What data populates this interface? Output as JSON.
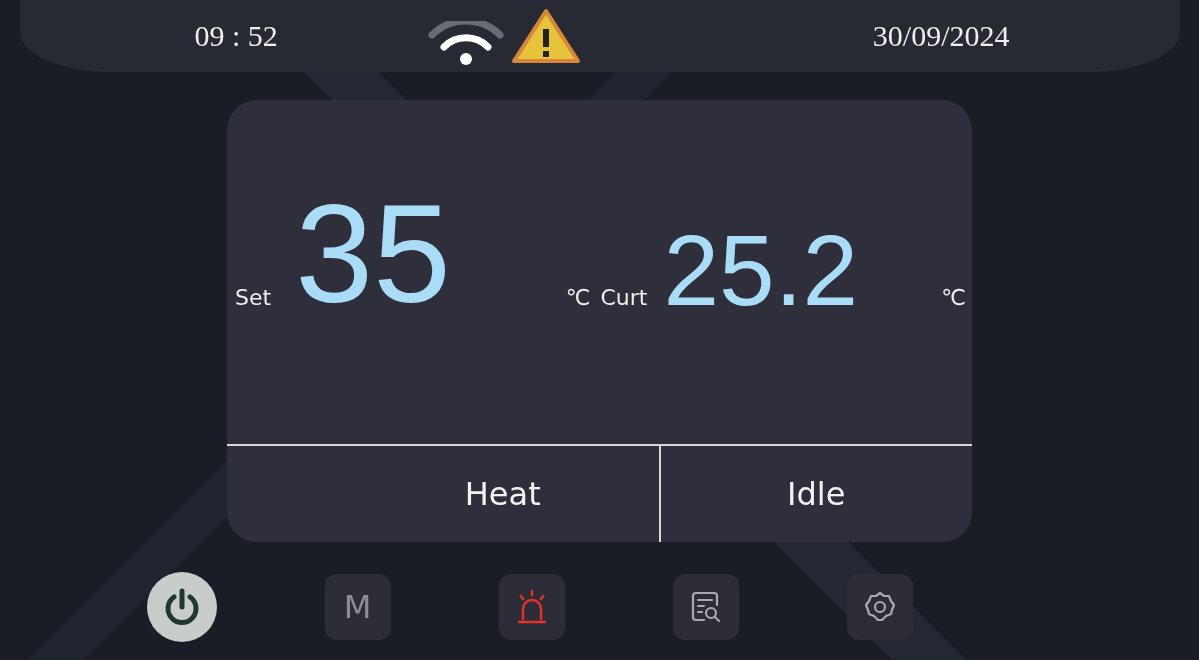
{
  "status_bar": {
    "time": "09 : 52",
    "wifi_connected": true,
    "warning": true,
    "date": "30/09/2024"
  },
  "display": {
    "set_label": "Set",
    "set_value": "35",
    "set_unit": "℃",
    "current_label": "Curt",
    "current_value": "25.2",
    "current_unit": "℃",
    "mode": "Heat",
    "state": "Idle"
  },
  "nav": [
    {
      "kind": "power"
    },
    {
      "kind": "mode",
      "label": "M"
    },
    {
      "kind": "alarm",
      "alert": true
    },
    {
      "kind": "log"
    },
    {
      "kind": "settings"
    }
  ]
}
